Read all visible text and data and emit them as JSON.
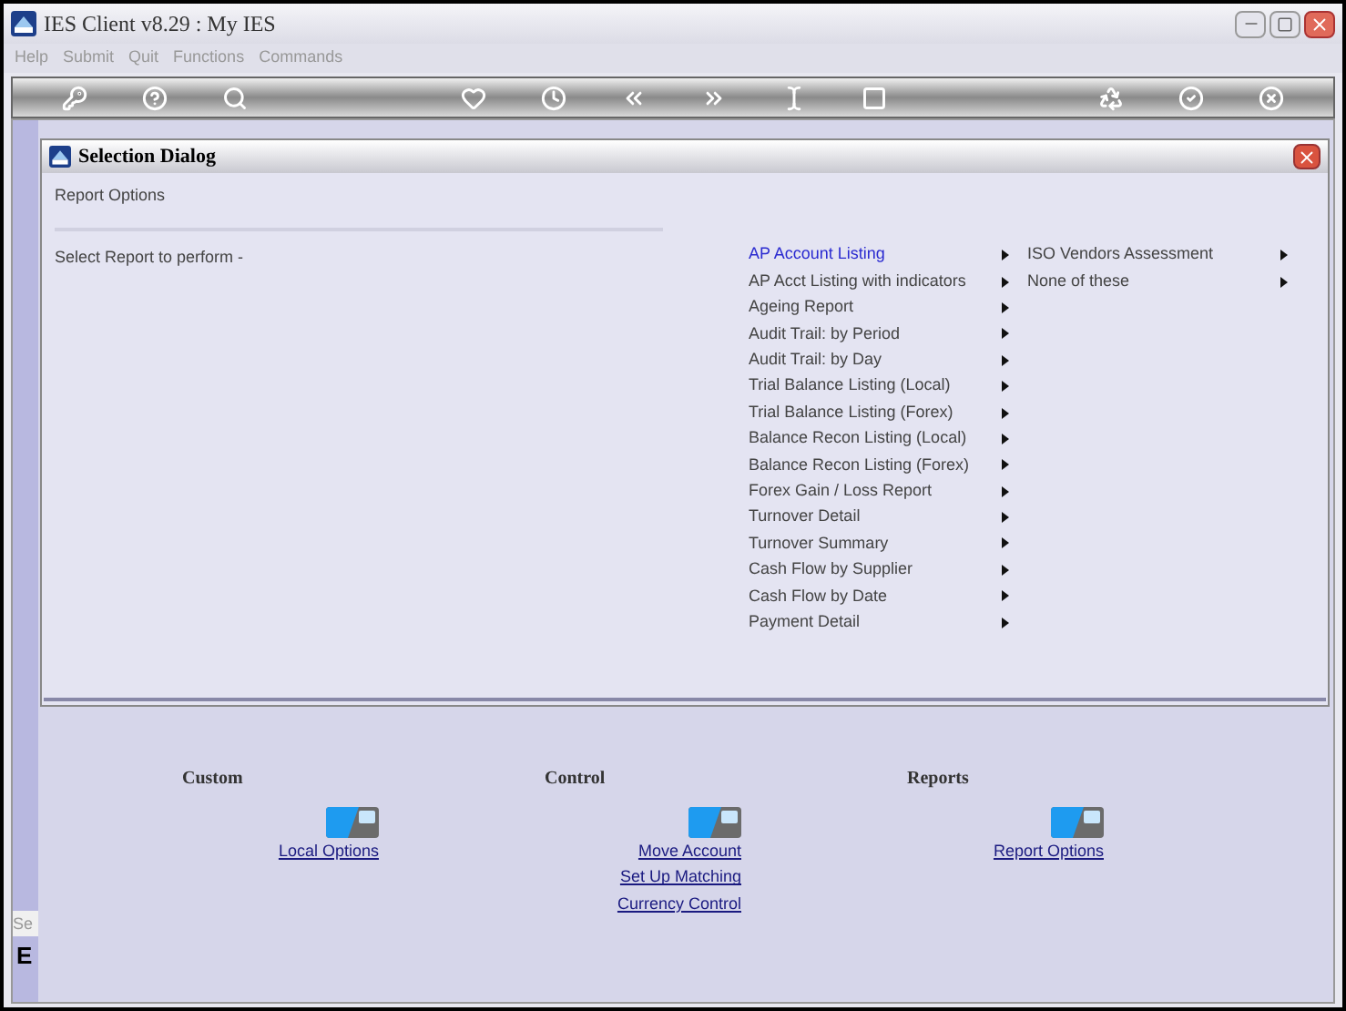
{
  "window": {
    "title": "IES Client v8.29 : My IES"
  },
  "menu": [
    "Help",
    "Submit",
    "Quit",
    "Functions",
    "Commands"
  ],
  "sidebar_fragments": [
    "Se",
    "E"
  ],
  "dialog": {
    "title": "Selection Dialog",
    "subtitle": "Report Options",
    "prompt": "Select Report to perform -",
    "columns": [
      [
        {
          "label": "AP Account Listing",
          "selected": true
        },
        {
          "label": "AP Acct Listing with indicators",
          "selected": false
        },
        {
          "label": "Ageing Report",
          "selected": false
        },
        {
          "label": "Audit Trail: by Period",
          "selected": false
        },
        {
          "label": "Audit Trail: by Day",
          "selected": false
        },
        {
          "label": "Trial Balance Listing (Local)",
          "selected": false
        },
        {
          "label": "Trial Balance Listing (Forex)",
          "selected": false
        },
        {
          "label": "Balance Recon Listing (Local)",
          "selected": false
        },
        {
          "label": "Balance Recon Listing (Forex)",
          "selected": false
        },
        {
          "label": "Forex Gain / Loss Report",
          "selected": false
        },
        {
          "label": "Turnover Detail",
          "selected": false
        },
        {
          "label": "Turnover Summary",
          "selected": false
        },
        {
          "label": "Cash Flow by Supplier",
          "selected": false
        },
        {
          "label": "Cash Flow by Date",
          "selected": false
        },
        {
          "label": "Payment Detail",
          "selected": false
        }
      ],
      [
        {
          "label": "ISO Vendors Assessment",
          "selected": false
        },
        {
          "label": "None of these",
          "selected": false
        }
      ]
    ]
  },
  "groups": [
    {
      "heading": "Custom",
      "links": [
        "Local Options"
      ]
    },
    {
      "heading": "Control",
      "links": [
        "Move Account",
        "Set Up Matching",
        "Currency Control"
      ]
    },
    {
      "heading": "Reports",
      "links": [
        "Report Options"
      ]
    }
  ]
}
